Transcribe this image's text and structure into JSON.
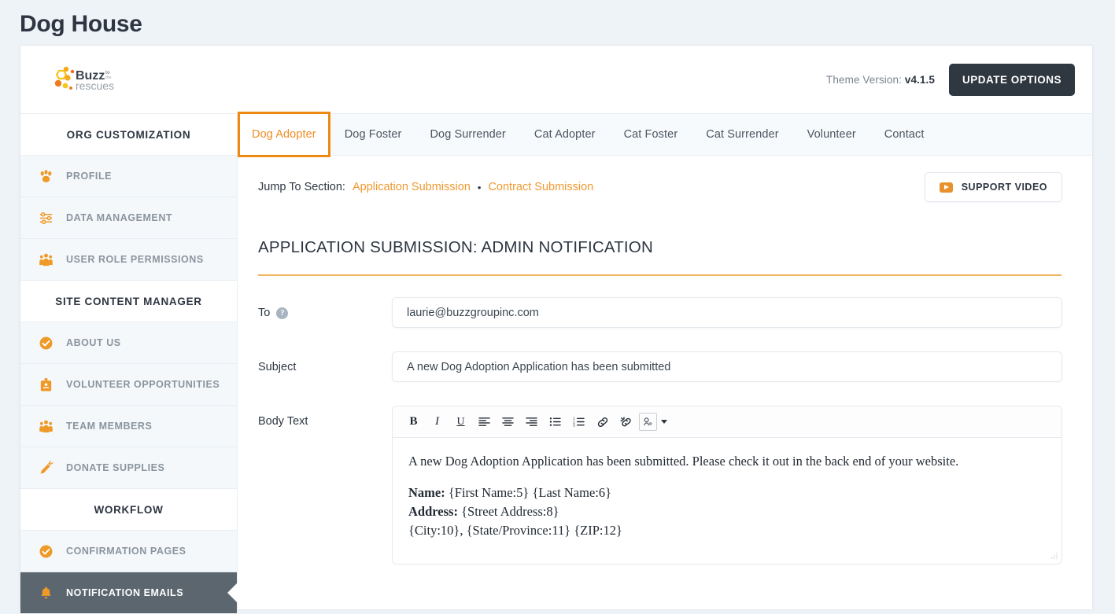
{
  "page": {
    "title": "Dog House"
  },
  "topbar": {
    "logo_name": "buzz-to-the-rescues-logo",
    "logo_text_main": "Buzz",
    "logo_text_small1": "to",
    "logo_text_small2": "the",
    "logo_text_sub": "rescues",
    "theme_version_label": "Theme Version:",
    "theme_version_value": "v4.1.5",
    "update_button": "UPDATE OPTIONS"
  },
  "sidebar": {
    "sections": [
      {
        "heading": "ORG CUSTOMIZATION",
        "items": [
          {
            "label": "PROFILE",
            "icon": "paw-icon",
            "active": false
          },
          {
            "label": "DATA MANAGEMENT",
            "icon": "sliders-icon",
            "active": false
          },
          {
            "label": "USER ROLE PERMISSIONS",
            "icon": "people-group-icon",
            "active": false
          }
        ]
      },
      {
        "heading": "SITE CONTENT MANAGER",
        "items": [
          {
            "label": "ABOUT US",
            "icon": "check-circle-icon",
            "active": false
          },
          {
            "label": "VOLUNTEER OPPORTUNITIES",
            "icon": "id-badge-icon",
            "active": false
          },
          {
            "label": "TEAM MEMBERS",
            "icon": "people-group-icon",
            "active": false
          },
          {
            "label": "DONATE SUPPLIES",
            "icon": "carrot-icon",
            "active": false
          }
        ]
      },
      {
        "heading": "WORKFLOW",
        "items": [
          {
            "label": "CONFIRMATION PAGES",
            "icon": "check-circle-icon",
            "active": false
          },
          {
            "label": "NOTIFICATION EMAILS",
            "icon": "bell-icon",
            "active": true
          }
        ]
      }
    ]
  },
  "tabs": [
    {
      "label": "Dog Adopter",
      "active": true
    },
    {
      "label": "Dog Foster",
      "active": false
    },
    {
      "label": "Dog Surrender",
      "active": false
    },
    {
      "label": "Cat Adopter",
      "active": false
    },
    {
      "label": "Cat Foster",
      "active": false
    },
    {
      "label": "Cat Surrender",
      "active": false
    },
    {
      "label": "Volunteer",
      "active": false
    },
    {
      "label": "Contact",
      "active": false
    }
  ],
  "jump_to_section": {
    "label": "Jump To Section:",
    "separator": "•",
    "links": [
      "Application Submission",
      "Contract Submission"
    ]
  },
  "support_video_button": {
    "label": "SUPPORT VIDEO",
    "icon": "play-video-icon"
  },
  "section": {
    "title": "APPLICATION SUBMISSION: ADMIN NOTIFICATION"
  },
  "form": {
    "to": {
      "label": "To",
      "help_icon": "help-question-icon",
      "value": "laurie@buzzgroupinc.com",
      "placeholder": "To"
    },
    "subject": {
      "label": "Subject",
      "value": "A new Dog Adoption Application has been submitted",
      "placeholder": "Subject"
    },
    "body": {
      "label": "Body Text",
      "toolbar": [
        {
          "name": "bold-icon",
          "label": "B"
        },
        {
          "name": "italic-icon",
          "label": "I"
        },
        {
          "name": "underline-icon",
          "label": "U"
        },
        {
          "name": "align-left-icon",
          "label": ""
        },
        {
          "name": "align-center-icon",
          "label": ""
        },
        {
          "name": "align-right-icon",
          "label": ""
        },
        {
          "name": "bulleted-list-icon",
          "label": ""
        },
        {
          "name": "numbered-list-icon",
          "label": ""
        },
        {
          "name": "link-icon",
          "label": ""
        },
        {
          "name": "unlink-icon",
          "label": ""
        },
        {
          "name": "insert-media-icon",
          "label": ""
        }
      ],
      "paragraph": "A new Dog Adoption Application has been submitted. Please check it out in the back end of your website.",
      "lines": [
        {
          "bold": "Name:",
          "rest": " {First Name:5} {Last Name:6}"
        },
        {
          "bold": "Address:",
          "rest": " {Street Address:8}"
        },
        {
          "bold": "",
          "rest": "{City:10}, {State/Province:11} {ZIP:12}"
        }
      ]
    }
  },
  "colors": {
    "accent_orange": "#f0992f",
    "tab_highlight": "#ee8a11",
    "dark": "#2f3740",
    "sidebar_active": "#5b666f",
    "page_bg": "#eef3f7"
  }
}
